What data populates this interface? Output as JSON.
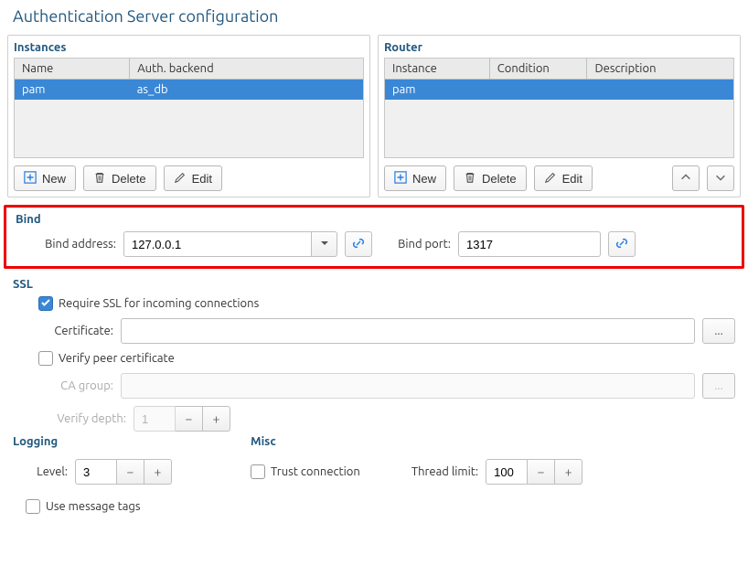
{
  "title": "Authentication Server configuration",
  "instances": {
    "heading": "Instances",
    "columns": [
      "Name",
      "Auth. backend"
    ],
    "rows": [
      {
        "name": "pam",
        "backend": "as_db"
      }
    ],
    "buttons": {
      "new": "New",
      "delete": "Delete",
      "edit": "Edit"
    }
  },
  "router": {
    "heading": "Router",
    "columns": [
      "Instance",
      "Condition",
      "Description"
    ],
    "rows": [
      {
        "instance": "pam",
        "condition": "",
        "description": ""
      }
    ],
    "buttons": {
      "new": "New",
      "delete": "Delete",
      "edit": "Edit"
    }
  },
  "bind": {
    "heading": "Bind",
    "address_label": "Bind address:",
    "address_value": "127.0.0.1",
    "port_label": "Bind port:",
    "port_value": "1317"
  },
  "ssl": {
    "heading": "SSL",
    "require_label": "Require SSL for incoming connections",
    "require_checked": true,
    "certificate_label": "Certificate:",
    "certificate_value": "",
    "verify_peer_label": "Verify peer certificate",
    "verify_peer_checked": false,
    "ca_group_label": "CA group:",
    "ca_group_value": "",
    "verify_depth_label": "Verify depth:",
    "verify_depth_value": "1"
  },
  "logging": {
    "heading": "Logging",
    "level_label": "Level:",
    "level_value": "3",
    "use_tags_label": "Use message tags",
    "use_tags_checked": false
  },
  "misc": {
    "heading": "Misc",
    "trust_label": "Trust connection",
    "trust_checked": false,
    "thread_limit_label": "Thread limit:",
    "thread_limit_value": "100"
  },
  "colors": {
    "accent": "#3a87d6",
    "heading": "#21587f",
    "highlight_border": "#ef0000"
  }
}
